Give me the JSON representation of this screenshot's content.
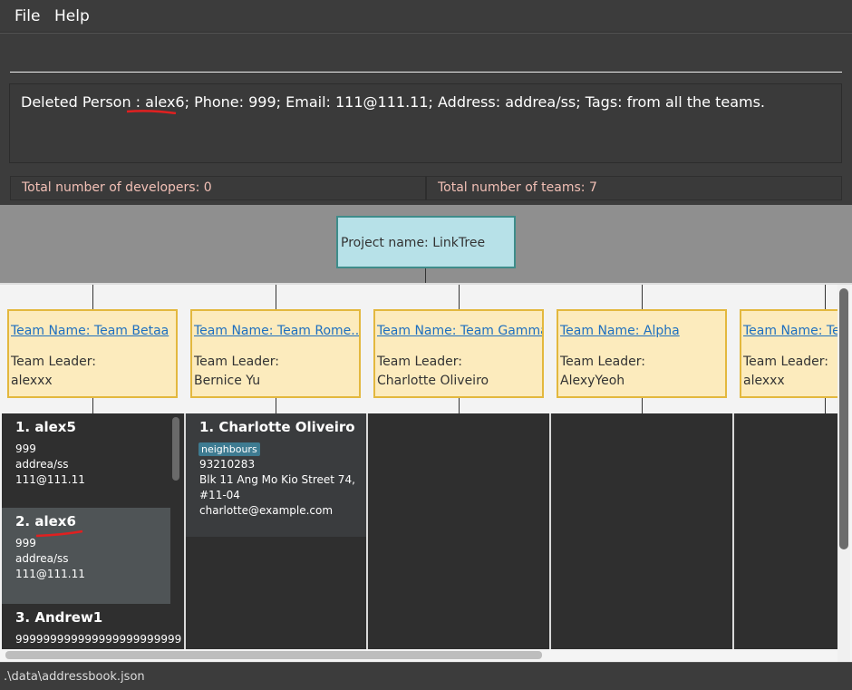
{
  "menu": {
    "file": "File",
    "help": "Help"
  },
  "command": {
    "value": "",
    "placeholder": ""
  },
  "result": {
    "message": "Deleted Person : alex6; Phone: 999; Email: 111@111.11; Address: addrea/ss; Tags:  from all the teams."
  },
  "stats": {
    "developers": "Total number of developers: 0",
    "teams": "Total number of teams: 7"
  },
  "project": {
    "label": "Project name: LinkTree"
  },
  "teams": [
    {
      "name": "Team Name: Team Betaa",
      "leader_label": "Team Leader:",
      "leader": "alexxx"
    },
    {
      "name": "Team Name: Team Rome...",
      "leader_label": "Team Leader:",
      "leader": "Bernice Yu"
    },
    {
      "name": "Team Name: Team Gamma",
      "leader_label": "Team Leader:",
      "leader": "Charlotte Oliveiro"
    },
    {
      "name": "Team Name: Alpha",
      "leader_label": "Team Leader:",
      "leader": "AlexyYeoh"
    },
    {
      "name": "Team Name: Te",
      "leader_label": "Team Leader:",
      "leader": "alexxx"
    }
  ],
  "column1": [
    {
      "name": "1.  alex5",
      "phone": "999",
      "address": "addrea/ss",
      "email": "111@111.11"
    },
    {
      "name": "2.  alex6",
      "phone": "999",
      "address": "addrea/ss",
      "email": "111@111.11"
    },
    {
      "name": "3.  Andrew1",
      "phone": "999999999999999999999999"
    }
  ],
  "column2": [
    {
      "name": "1.  Charlotte Oliveiro",
      "tag": "neighbours",
      "phone": "93210283",
      "address1": "Blk 11 Ang Mo Kio Street 74,",
      "address2": "#11-04",
      "email": "charlotte@example.com"
    }
  ],
  "status": {
    "path": ".\\data\\addressbook.json"
  },
  "colors": {
    "accent_team_link": "#1e6fbf",
    "card_bg": "#fcebbd",
    "card_border": "#e3b83e",
    "project_bg": "#b7e1e8",
    "annotation_red": "#e02020"
  }
}
